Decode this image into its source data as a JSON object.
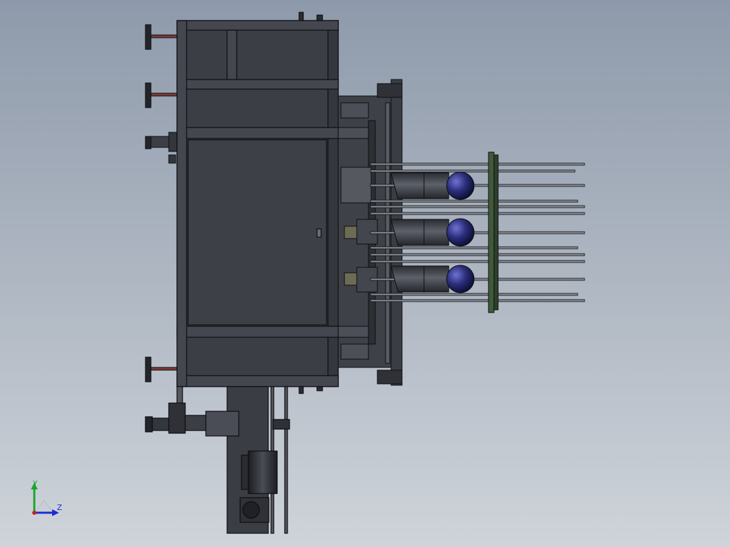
{
  "viewport": {
    "background_top": "#8e9aab",
    "background_bottom": "#cfd4da",
    "model_color": "#3b3e45",
    "edge_color": "#0c0d10",
    "sphere_color": "#2a2d7a"
  },
  "triad": {
    "y_label": "Y",
    "z_label": "Z",
    "y_color": "#1aa52a",
    "z_color": "#1b2bd6"
  }
}
